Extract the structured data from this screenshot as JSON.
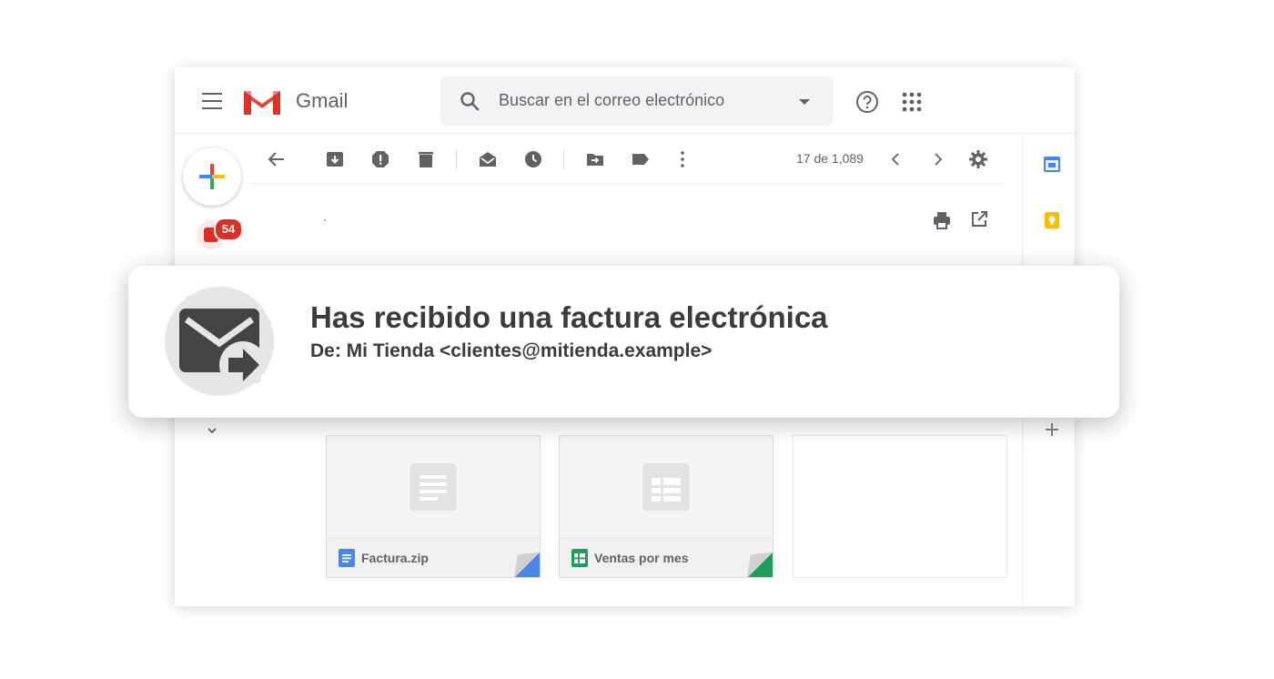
{
  "app": {
    "name": "Gmail"
  },
  "search": {
    "placeholder": "Buscar en el correo electrónico"
  },
  "left_rail": {
    "inbox_badge": "54"
  },
  "toolbar": {
    "pager": "17 de 1,089"
  },
  "attachments": [
    {
      "name": "Factura.zip",
      "type": "docs",
      "accent": "#4a86e8"
    },
    {
      "name": "Ventas por mes",
      "type": "sheets",
      "accent": "#1e9d5b"
    }
  ],
  "notification": {
    "title": "Has recibido una factura electrónica",
    "from": "De: Mi Tienda <clientes@mitienda.example>"
  },
  "icons": [
    "menu-icon",
    "gmail-logo",
    "search-icon",
    "help-icon",
    "apps-icon",
    "compose-icon",
    "back-arrow-icon",
    "archive-icon",
    "report-spam-icon",
    "delete-icon",
    "mark-unread-icon",
    "snooze-icon",
    "move-to-icon",
    "label-icon",
    "more-icon",
    "prev-icon",
    "next-icon",
    "settings-icon",
    "print-icon",
    "open-new-window-icon",
    "calendar-icon",
    "keep-icon",
    "add-icon",
    "forward-mail-icon"
  ],
  "colors": {
    "gmail_red": "#d93025",
    "text_dark": "#3b3b3b",
    "icon_gray": "#5f6368"
  }
}
